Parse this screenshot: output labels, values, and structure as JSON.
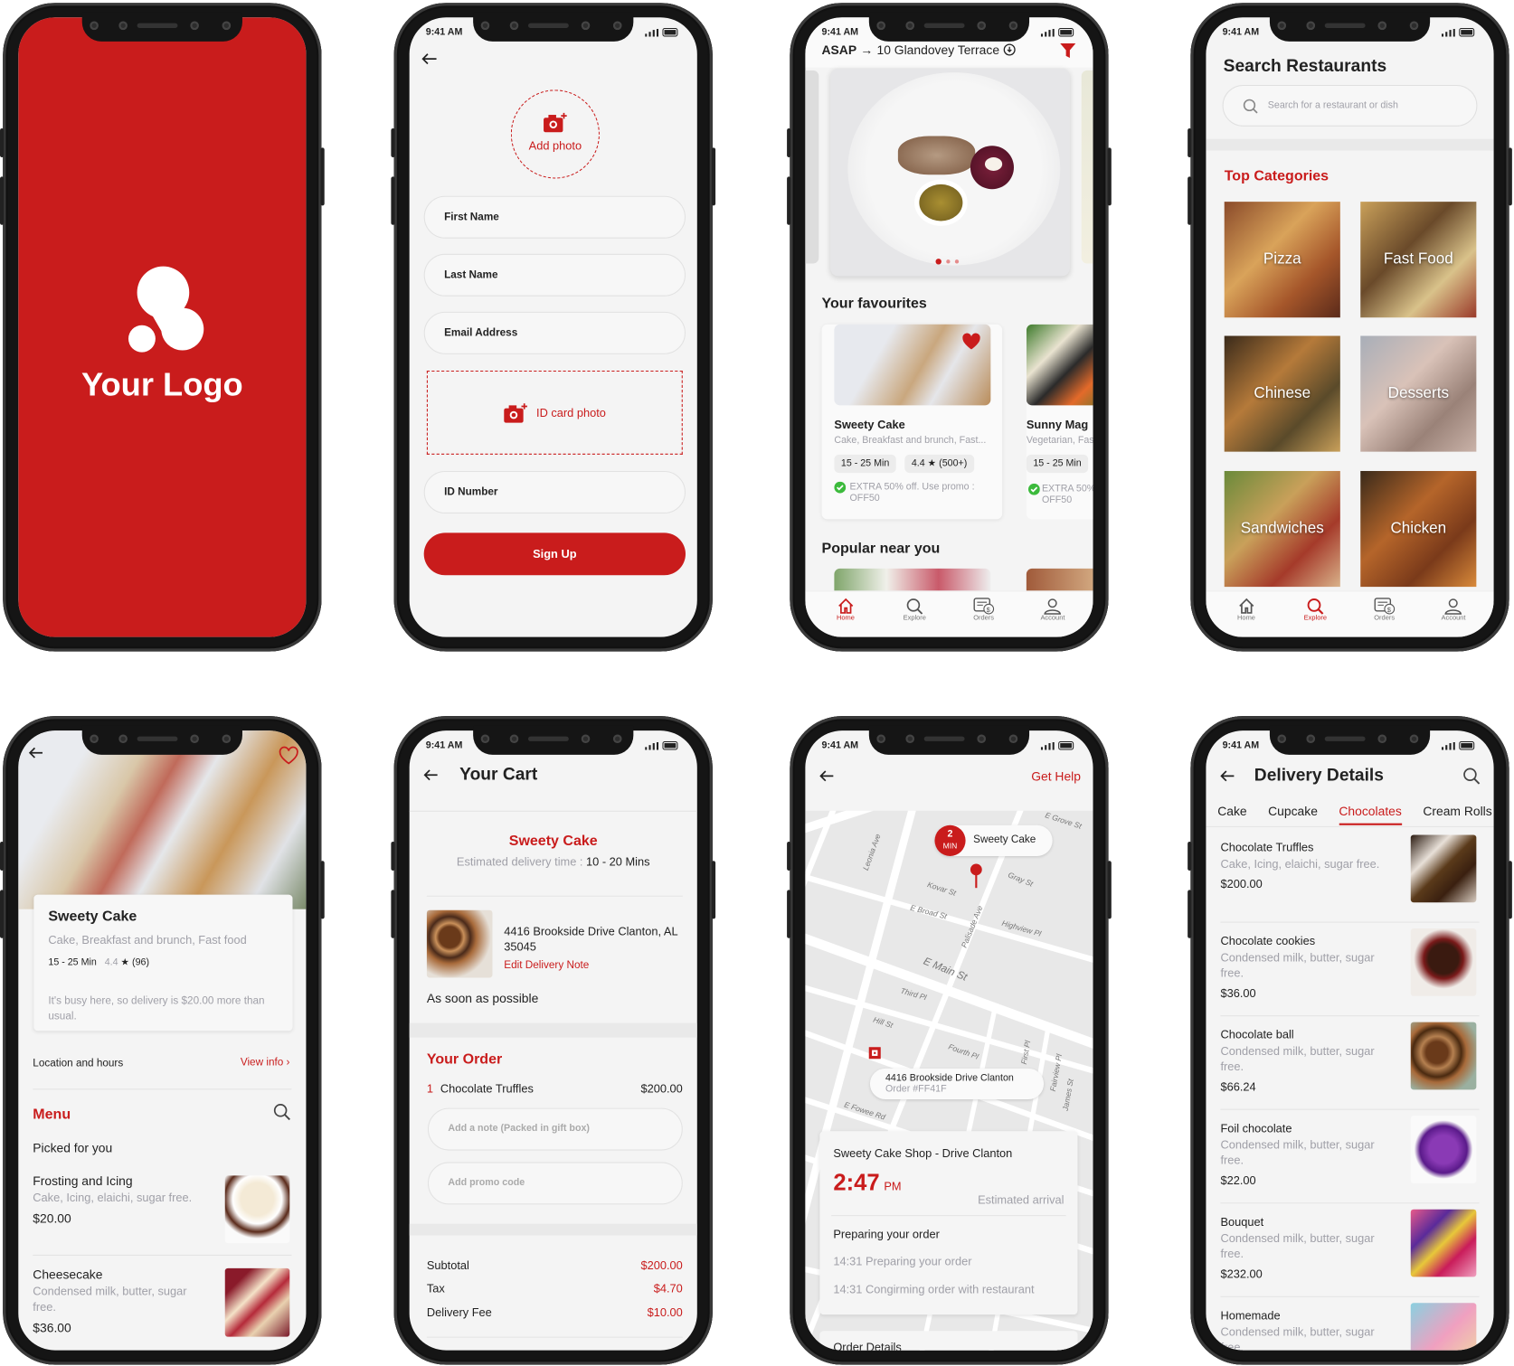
{
  "status_time": "9:41 AM",
  "colors": {
    "brand": "#c91c1c",
    "background": "#f4f4f4",
    "muted": "#a0a0a8",
    "success": "#3cba3c"
  },
  "splash": {
    "logo_text": "Your Logo"
  },
  "signup": {
    "add_photo": "Add photo",
    "first_name": "First Name",
    "last_name": "Last Name",
    "email": "Email Address",
    "id_card_photo": "ID card photo",
    "id_number": "ID Number",
    "sign_up": "Sign Up"
  },
  "home": {
    "asap": "ASAP",
    "address": "10 Glandovey Terrace",
    "favourites_title": "Your favourites",
    "popular_title": "Popular near you",
    "cards": [
      {
        "name": "Sweety Cake",
        "tags": "Cake, Breakfast and brunch, Fast...",
        "time": "15 - 25 Min",
        "rating": "4.4",
        "reviews": "(500+)",
        "promo": "EXTRA 50% off. Use promo : OFF50"
      },
      {
        "name": "Sunny Mag",
        "tags": "Vegetarian, Fas",
        "time": "15 - 25 Min",
        "promo": "EXTRA 50% OFF50"
      }
    ]
  },
  "nav": {
    "home": "Home",
    "explore": "Explore",
    "orders": "Orders",
    "account": "Account"
  },
  "search": {
    "title": "Search Restaurants",
    "placeholder": "Search for a restaurant or dish",
    "categories_title": "Top Categories",
    "categories": [
      "Pizza",
      "Fast Food",
      "Chinese",
      "Desserts",
      "Sandwiches",
      "Chicken"
    ]
  },
  "restaurant": {
    "name": "Sweety Cake",
    "tags": "Cake, Breakfast and brunch, Fast food",
    "time": "15 - 25 Min",
    "rating": "4.4",
    "reviews": "(96)",
    "busy_note": "It's busy here, so delivery is $20.00 more than usual.",
    "location_label": "Location and hours",
    "view_info": "View info",
    "menu_title": "Menu",
    "picked_title": "Picked for you",
    "items": [
      {
        "name": "Frosting and Icing",
        "desc": "Cake, Icing, elaichi, sugar free.",
        "price": "$20.00"
      },
      {
        "name": "Cheesecake",
        "desc": "Condensed milk, butter, sugar free.",
        "price": "$36.00"
      }
    ]
  },
  "cart": {
    "title": "Your Cart",
    "shop": "Sweety Cake",
    "est_label": "Estimated delivery  time :",
    "est_value": "10 - 20 Mins",
    "address": "4416 Brookside Drive Clanton, AL 35045",
    "edit_note": "Edit Delivery Note",
    "when": "As soon as possible",
    "order_title": "Your Order",
    "line": {
      "qty": "1",
      "name": "Chocolate Truffles",
      "price": "$200.00"
    },
    "note_placeholder": "Add a note (Packed in gift box)",
    "promo_placeholder": "Add promo code",
    "totals": [
      {
        "label": "Subtotal",
        "value": "$200.00"
      },
      {
        "label": "Tax",
        "value": "$4.70"
      },
      {
        "label": "Delivery Fee",
        "value": "$10.00"
      }
    ]
  },
  "tracking": {
    "get_help": "Get Help",
    "eta_num": "2",
    "eta_unit": "MIN",
    "shop_bubble": "Sweety Cake",
    "dest": "4416 Brookside Drive Clanton",
    "order_id": "Order #FF41F",
    "shop_name": "Sweety Cake Shop - Drive Clanton",
    "arrival_time": "2:47",
    "arrival_ampm": "PM",
    "arrival_label": "Estimated arrival",
    "stage": "Preparing your order",
    "log": [
      "14:31 Preparing your order",
      "14:31 Congirming order with restaurant"
    ],
    "order_details": "Order Details",
    "streets": [
      "E Grove St",
      "Leonia Ave",
      "Kovar St",
      "Gray St",
      "E Broad St",
      "Palisade Ave",
      "Highview Pl",
      "E Main St",
      "Third Pl",
      "Hill St",
      "Fourth Pl",
      "First Pl",
      "Fairview Pl",
      "James St",
      "E Fowee Rd",
      "West End Ave",
      "Beechwood"
    ]
  },
  "delivery": {
    "title": "Delivery Details",
    "tabs": [
      "Cake",
      "Cupcake",
      "Chocolates",
      "Cream Rolls"
    ],
    "active_tab": "Chocolates",
    "items": [
      {
        "name": "Chocolate Truffles",
        "desc": "Cake, Icing, elaichi, sugar free.",
        "price": "$200.00"
      },
      {
        "name": "Chocolate cookies",
        "desc": "Condensed milk, butter, sugar free.",
        "price": "$36.00"
      },
      {
        "name": "Chocolate ball",
        "desc": "Condensed milk, butter, sugar free.",
        "price": "$66.24"
      },
      {
        "name": "Foil chocolate",
        "desc": "Condensed milk, butter, sugar free.",
        "price": "$22.00"
      },
      {
        "name": "Bouquet",
        "desc": "Condensed milk, butter, sugar free.",
        "price": "$232.00"
      },
      {
        "name": "Homemade",
        "desc": "Condensed milk, butter, sugar free.",
        "price": ""
      }
    ]
  }
}
